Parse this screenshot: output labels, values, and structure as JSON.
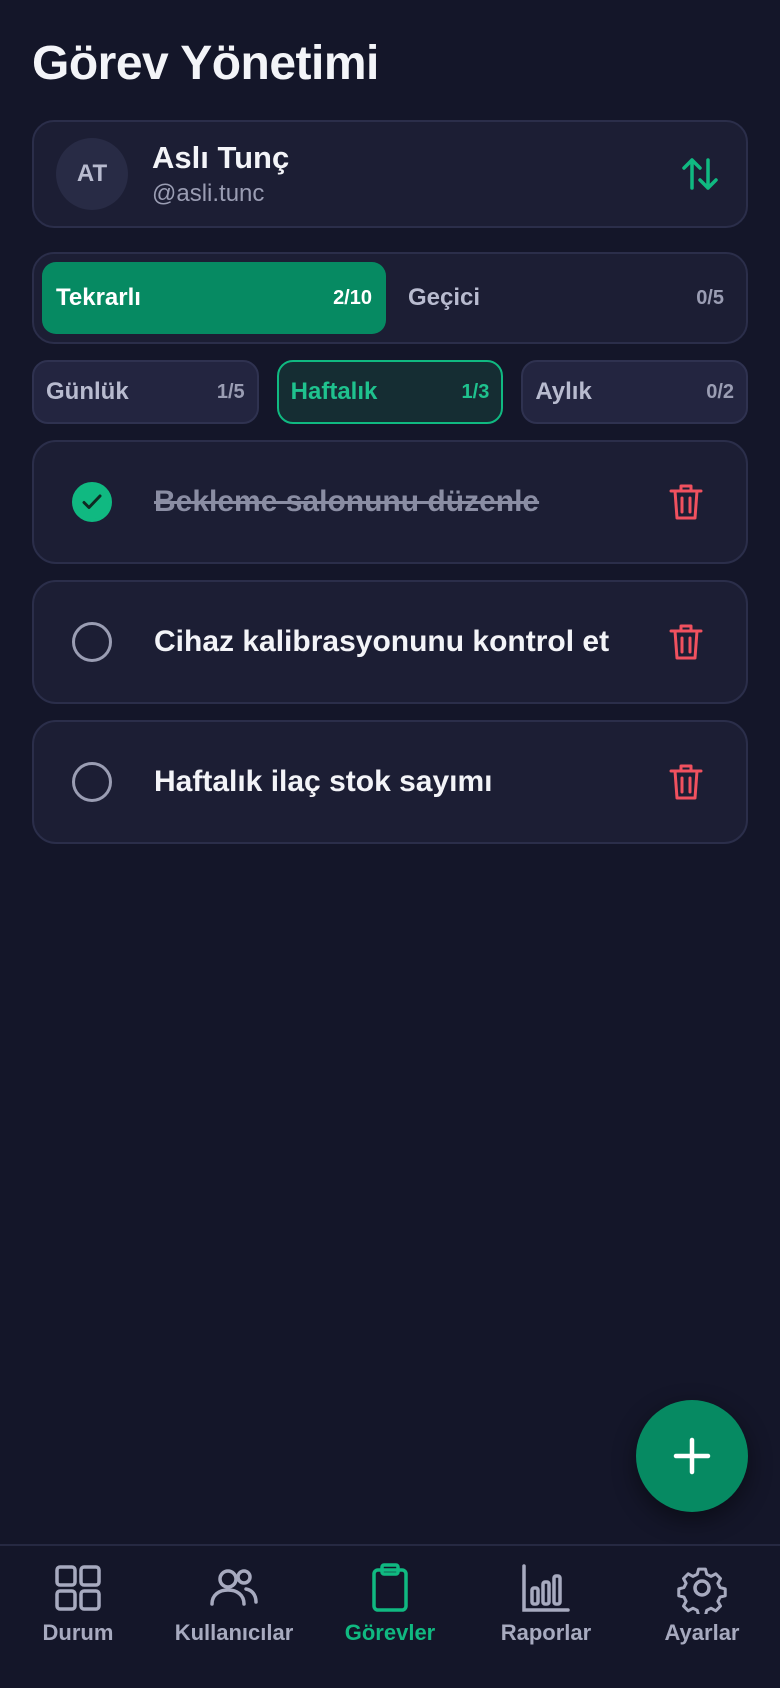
{
  "header": {
    "title": "Görev Yönetimi"
  },
  "user": {
    "initials": "AT",
    "name": "Aslı Tunç",
    "handle": "@asli.tunc",
    "switch_icon": "swap-vertical-icon"
  },
  "type_tabs": [
    {
      "label": "Tekrarlı",
      "count": "2/10",
      "active": true
    },
    {
      "label": "Geçici",
      "count": "0/5",
      "active": false
    }
  ],
  "freq_tabs": [
    {
      "label": "Günlük",
      "count": "1/5",
      "active": false
    },
    {
      "label": "Haftalık",
      "count": "1/3",
      "active": true
    },
    {
      "label": "Aylık",
      "count": "0/2",
      "active": false
    }
  ],
  "tasks": [
    {
      "title": "Bekleme salonunu düzenle",
      "done": true
    },
    {
      "title": "Cihaz kalibrasyonunu kontrol et",
      "done": false
    },
    {
      "title": "Haftalık ilaç stok sayımı",
      "done": false
    }
  ],
  "fab": {
    "icon": "plus-icon"
  },
  "nav": [
    {
      "label": "Durum",
      "icon": "grid-icon",
      "active": false
    },
    {
      "label": "Kullanıcılar",
      "icon": "users-icon",
      "active": false
    },
    {
      "label": "Görevler",
      "icon": "clipboard-icon",
      "active": true
    },
    {
      "label": "Raporlar",
      "icon": "bar-chart-icon",
      "active": false
    },
    {
      "label": "Ayarlar",
      "icon": "gear-icon",
      "active": false
    }
  ],
  "colors": {
    "background": "#141629",
    "card": "#1c1e34",
    "accent": "#10b981",
    "accent_dark": "#068a62",
    "danger": "#f0515f"
  }
}
